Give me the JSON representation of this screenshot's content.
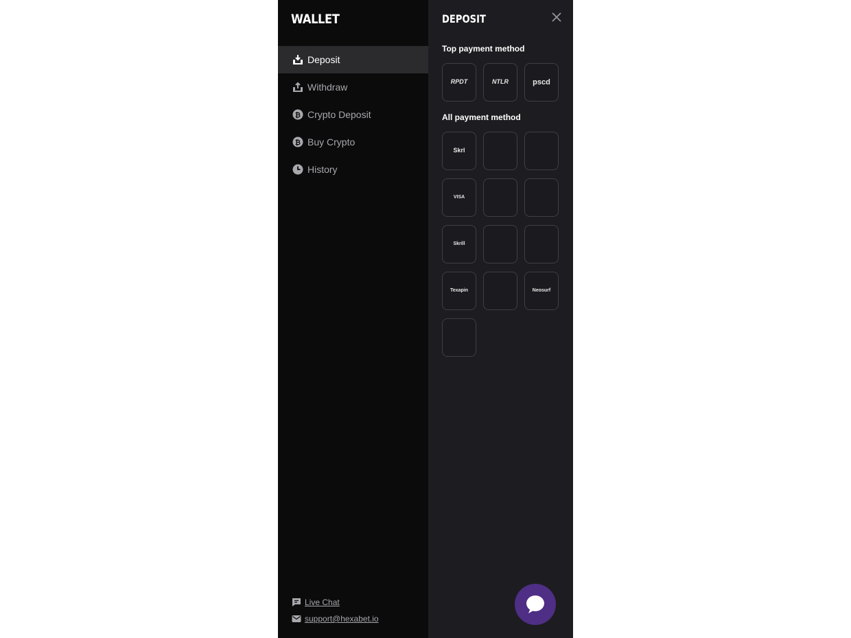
{
  "sidebar": {
    "title": "WALLET",
    "items": [
      {
        "label": "Deposit",
        "icon": "deposit-icon"
      },
      {
        "label": "Withdraw",
        "icon": "withdraw-icon"
      },
      {
        "label": "Crypto Deposit",
        "icon": "bitcoin-icon"
      },
      {
        "label": "Buy Crypto",
        "icon": "bitcoin-icon"
      },
      {
        "label": "History",
        "icon": "clock-icon"
      }
    ],
    "footer": {
      "live_chat": "Live Chat",
      "email": "support@hexabet.io"
    }
  },
  "panel": {
    "title": "DEPOSIT",
    "top_label": "Top payment method",
    "all_label": "All payment method",
    "top_methods": [
      "RPDT",
      "NTLR",
      "pscd"
    ],
    "all_methods": [
      "Skrl",
      "",
      "",
      "VISA",
      "",
      "",
      "Skrill",
      "",
      "",
      "Texapin",
      "",
      "Neosurf",
      ""
    ]
  },
  "colors": {
    "sidebar_bg": "#0b0b0c",
    "panel_bg": "#1d1d21",
    "active_item_bg": "#2b2b2e",
    "chat_button": "#4f2e86"
  }
}
